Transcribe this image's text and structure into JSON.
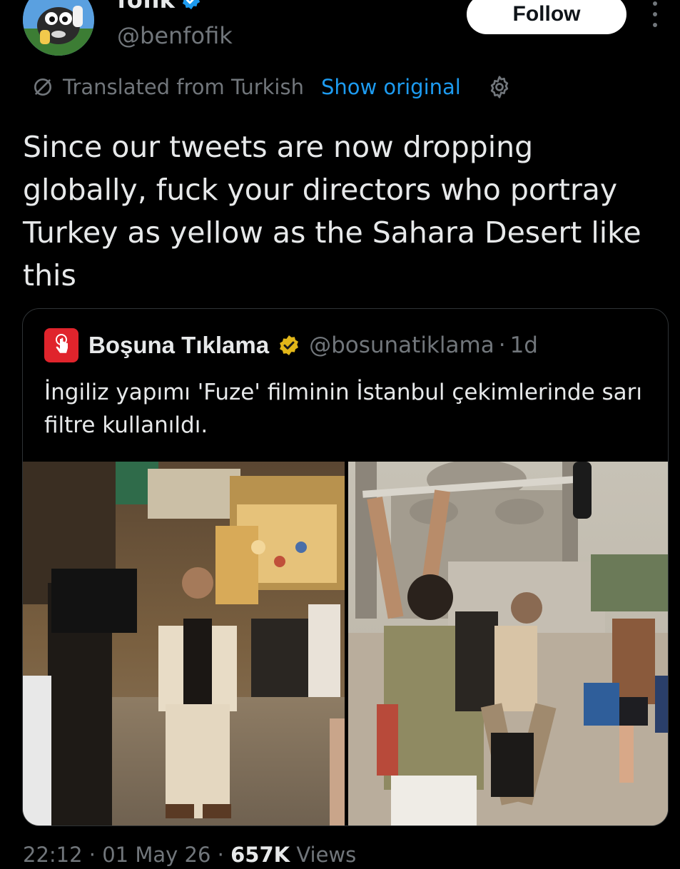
{
  "author": {
    "display_name": "fofik",
    "handle": "@benfofik"
  },
  "header": {
    "follow_label": "Follow"
  },
  "translation": {
    "label": "Translated from Turkish",
    "show_original": "Show original"
  },
  "tweet": {
    "text": "Since our tweets are now dropping globally, fuck your directors who portray Turkey as yellow as the Sahara Desert like this"
  },
  "quote": {
    "name": "Boşuna Tıklama",
    "handle": "@bosunatiklama",
    "separator": "·",
    "time": "1d",
    "text": "İngiliz yapımı 'Fuze' filminin İstanbul çekimlerinde sarı filtre kullanıldı."
  },
  "meta": {
    "time": "22:12",
    "separator": "·",
    "date": "01 May 26",
    "views_count": "657K",
    "views_label": "Views"
  },
  "colors": {
    "background": "#000000",
    "text": "#e7e9ea",
    "secondary": "#71767b",
    "link": "#1d9bf0",
    "verified_blue": "#1d9bf0",
    "verified_gold": "#e2b719",
    "brand_red": "#e0242c"
  }
}
